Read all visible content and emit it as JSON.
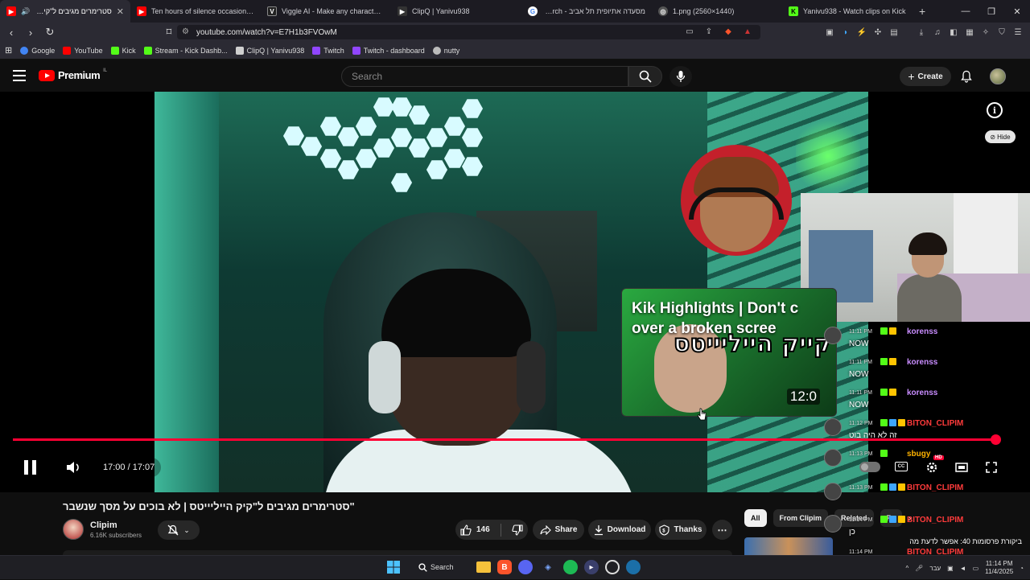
{
  "browser": {
    "tabs": [
      {
        "label": "סטרימרים מגיבים ל\"קיק הייל",
        "icon": "youtube-red",
        "active": true
      },
      {
        "label": "Ten hours of silence occasionally bro",
        "icon": "youtube-red"
      },
      {
        "label": "Viggle AI - Make any character move",
        "icon": "viggle"
      },
      {
        "label": "ClipQ | Yanivu938",
        "icon": "clipq"
      },
      {
        "label": "מסעדה אתיופית תל אביב - Search",
        "icon": "google"
      },
      {
        "label": "1.png (2560×1440)",
        "icon": "image"
      },
      {
        "label": "Yanivu938 - Watch clips on Kick",
        "icon": "kick"
      }
    ],
    "url": "youtube.com/watch?v=E7H1b3FVOwM",
    "bookmarks": [
      {
        "label": "Google",
        "color": "#4285f4"
      },
      {
        "label": "YouTube",
        "color": "#ff0000"
      },
      {
        "label": "Kick",
        "color": "#53fc18"
      },
      {
        "label": "Stream - Kick Dashb...",
        "color": "#53fc18"
      },
      {
        "label": "ClipQ | Yanivu938",
        "color": "#cfcfcf"
      },
      {
        "label": "Twitch",
        "color": "#9146ff"
      },
      {
        "label": "Twitch - dashboard",
        "color": "#9146ff"
      },
      {
        "label": "nutty",
        "color": "#bbbbbb"
      }
    ]
  },
  "youtube": {
    "brand": "Premium",
    "country_code": "IL",
    "search_placeholder": "Search",
    "create_label": "Create",
    "hide_label": "Hide",
    "player": {
      "current_time": "17:00",
      "duration": "17:07",
      "time_display": "17:00 / 17:07",
      "progress_fraction": 0.993,
      "hd_badge": "HD",
      "endcard": {
        "title": "Kik Highlights | Don't c over a broken scree",
        "hebrew_title": "קייק הייליייטס",
        "duration": "12:0"
      },
      "chat": [
        {
          "time": "11:11 PM",
          "user": "korenss",
          "text": "NOW",
          "color": "#c98dff"
        },
        {
          "time": "11:11 PM",
          "user": "korenss",
          "text": "NOW",
          "color": "#c98dff"
        },
        {
          "time": "11:11 PM",
          "user": "korenss",
          "text": "NOW",
          "color": "#c98dff"
        },
        {
          "time": "11:12 PM",
          "user": "BITON_CLIPIM",
          "text": "זה לא היה בוט",
          "color": "#ff3b3b"
        },
        {
          "time": "11:13 PM",
          "user": "sbugy",
          "text": "",
          "color": "#ffb300"
        },
        {
          "time": "11:13 PM",
          "user": "BITON_CLIPIM",
          "text": "",
          "color": "#ff3b3b"
        },
        {
          "time": "11:14 PM",
          "user": "BITON_CLIPIM",
          "text": "כן",
          "color": "#ff3b3b"
        },
        {
          "time": "11:14 PM",
          "user": "BITON_CLIPIM",
          "text": "זה פה גם",
          "color": "#ff3b3b"
        }
      ],
      "chat_extra": "ביקורת פרסומות 40: אפשר לדעת מה"
    },
    "video": {
      "title": "\"סטרימרים מגיבים ל\"קיק הייליייטס | לא בוכים על מסך שנשבר",
      "channel": "Clipim",
      "subscribers": "6.16K subscribers",
      "likes": "146",
      "share_label": "Share",
      "download_label": "Download",
      "thanks_label": "Thanks"
    },
    "chips": [
      {
        "label": "All",
        "selected": true
      },
      {
        "label": "From Clipim",
        "selected": false
      },
      {
        "label": "Related",
        "selected": false
      },
      {
        "label": "Fo",
        "selected": false
      }
    ]
  },
  "taskbar": {
    "search_label": "Search",
    "lang": "עבר",
    "time": "11:14 PM",
    "date": "11/4/2025"
  },
  "colors": {
    "accent": "#ff0033",
    "kick": "#53fc18"
  }
}
